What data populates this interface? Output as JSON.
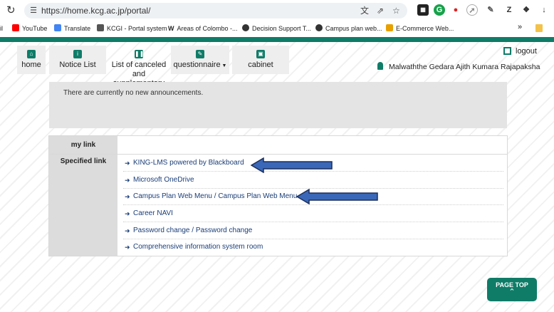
{
  "browser": {
    "url": "https://home.kcg.ac.jp/portal/",
    "bookmarks": [
      {
        "label": "il",
        "color": "#ffffff"
      },
      {
        "label": "YouTube",
        "color": "#ff0000"
      },
      {
        "label": "Translate",
        "color": "#4285f4"
      },
      {
        "label": "KCGI - Portal system",
        "color": "#444444"
      },
      {
        "label": "Areas of Colombo -...",
        "color": "#ffffff"
      },
      {
        "label": "Decision Support T...",
        "color": "#333333"
      },
      {
        "label": "Campus plan web...",
        "color": "#333333"
      },
      {
        "label": "E-Commerce Web...",
        "color": "#e8a000"
      }
    ],
    "more": "»"
  },
  "nav": {
    "items": [
      {
        "label": "home",
        "icon": "home-icon"
      },
      {
        "label": "Notice List",
        "icon": "info-icon"
      },
      {
        "label": "List of canceled and supplementary classes",
        "icon": "pause-icon"
      },
      {
        "label": "questionnaire",
        "icon": "edit-icon"
      },
      {
        "label": "cabinet",
        "icon": "cabinet-icon"
      }
    ],
    "logout": "logout",
    "user": "Malwaththe Gedara Ajith Kumara Rajapaksha"
  },
  "announcements": {
    "text": "There are currently no new announcements."
  },
  "links_panel": {
    "my_link_label": "my link",
    "specified_label": "Specified link",
    "links": [
      "KING-LMS powered by Blackboard",
      "Microsoft OneDrive",
      "Campus Plan Web Menu / Campus Plan Web Menu",
      "Career NAVI",
      "Password change / Password change",
      "Comprehensive information system room"
    ]
  },
  "page_top": {
    "label": "PAGE TOP",
    "icon": "chevron-up-icon"
  },
  "colors": {
    "accent": "#0f7c68",
    "link": "#1a3e78",
    "annotation_arrow": "#3a67b8"
  }
}
